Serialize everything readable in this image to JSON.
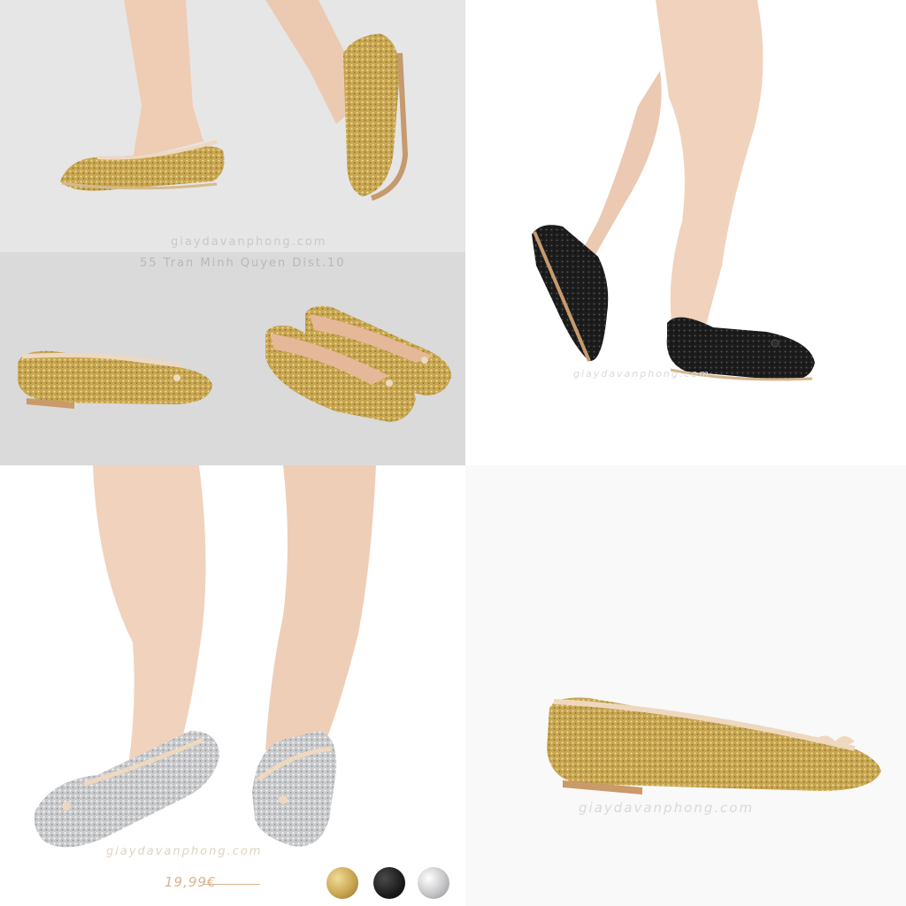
{
  "watermarks": {
    "top_left_site": "giaydavanphong.com",
    "top_left_address": "55 Tran Minh Quyen Dist.10",
    "top_right_site": "giaydavanphong.com",
    "bottom_left_site": "giaydavanphong.com",
    "bottom_right_site": "giaydavanphong.com"
  },
  "price": "19,99€",
  "swatches": [
    {
      "name": "gold",
      "color": "#c8a651"
    },
    {
      "name": "black",
      "color": "#1b1b1b"
    },
    {
      "name": "silver",
      "color": "#c6c6c8"
    }
  ],
  "colors": {
    "panel_grey": "#e4e4e4",
    "panel_grey_dark": "#dadada",
    "skin": "#efcdb5",
    "gold_glitter": "#c8a651",
    "silver_glitter": "#cfd0d2",
    "black_glitter": "#1c1c1c",
    "trim": "#eed8bf"
  }
}
